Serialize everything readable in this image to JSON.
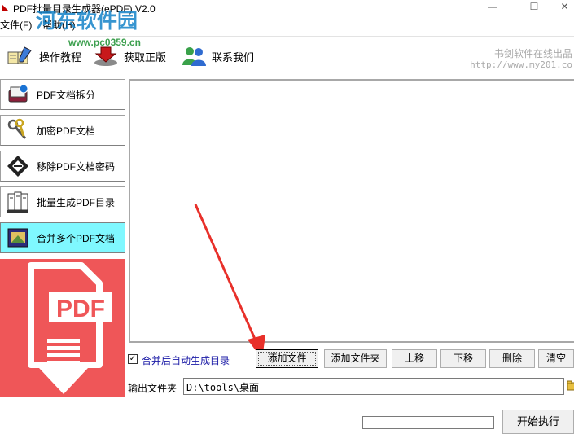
{
  "window": {
    "title": "PDF批量目录生成器(ePDF) V2.0",
    "minimize_glyph": "—",
    "maximize_glyph": "☐",
    "close_glyph": "✕"
  },
  "watermark": {
    "logo": "河东软件园",
    "url": "www.pc0359.cn"
  },
  "menu": {
    "file": "文件(F)",
    "help": "帮助(H)"
  },
  "toolbar": {
    "tutorial": {
      "label": "操作教程",
      "icon": "book-pencil-icon"
    },
    "buy": {
      "label": "获取正版",
      "icon": "download-arrow-icon"
    },
    "contact": {
      "label": "联系我们",
      "icon": "users-icon"
    },
    "credit": "书剑软件在线出品",
    "credit_url": "http://www.my201.co"
  },
  "sidebar": {
    "items": [
      {
        "label": "PDF文档拆分",
        "icon": "book-split-icon",
        "active": false
      },
      {
        "label": "加密PDF文档",
        "icon": "keys-icon",
        "active": false
      },
      {
        "label": "移除PDF文档密码",
        "icon": "key-diamond-icon",
        "active": false
      },
      {
        "label": "批量生成PDF目录",
        "icon": "documents-icon",
        "active": false
      },
      {
        "label": "合并多个PDF文档",
        "icon": "merge-doc-icon",
        "active": true
      }
    ]
  },
  "banner": {
    "text": "PDF"
  },
  "controls": {
    "auto_toc_checked": true,
    "auto_toc_label": "合并后自动生成目录",
    "buttons": {
      "add_file": "添加文件",
      "add_folder": "添加文件夹",
      "move_up": "上移",
      "move_down": "下移",
      "delete": "删除",
      "clear": "清空"
    },
    "output_label": "输出文件夹",
    "output_value": "D:\\tools\\桌面",
    "start": "开始执行",
    "progress": 0
  },
  "colors": {
    "active_item": "#7ff8ff",
    "banner": "#ef5658",
    "annotation_arrow": "#e8302a"
  }
}
